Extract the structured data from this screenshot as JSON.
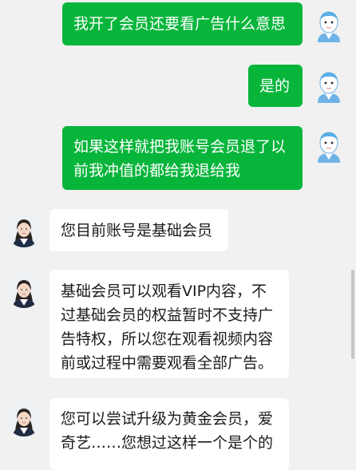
{
  "messages": [
    {
      "sender": "user",
      "text": "我开了会员还要看广告什么意思"
    },
    {
      "sender": "user",
      "text": "是的"
    },
    {
      "sender": "user",
      "text": "如果这样就把我账号会员退了以前我冲值的都给我退给我"
    },
    {
      "sender": "agent",
      "text": "您目前账号是基础会员"
    },
    {
      "sender": "agent",
      "text": "基础会员可以观看VIP内容，不过基础会员的权益暂时不支持广告特权，所以您在观看视频内容前或过程中需要观看全部广告。"
    },
    {
      "sender": "agent",
      "text": "您可以尝试升级为黄金会员，爱奇艺……您想过这样一个是个的"
    }
  ],
  "icons": {
    "user_avatar": "cartoon-user-avatar-icon",
    "agent_avatar": "customer-service-agent-avatar"
  },
  "colors": {
    "background": "#f1f1f1",
    "user_bubble": "#07b53b",
    "agent_bubble": "#ffffff",
    "user_text": "#ffffff",
    "agent_text": "#1b1b1b"
  }
}
